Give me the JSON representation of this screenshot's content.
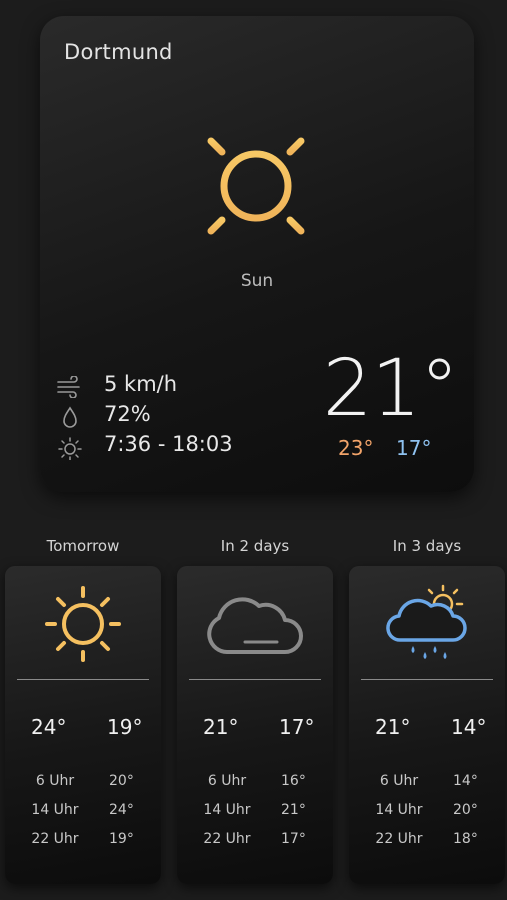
{
  "current": {
    "city": "Dortmund",
    "condition": "Sun",
    "condition_icon": "sun-icon",
    "wind": "5 km/h",
    "humidity": "72%",
    "sun_times": "7:36 - 18:03",
    "temperature": "21°",
    "high": "23°",
    "low": "17°",
    "colors": {
      "sun": "#f5c060",
      "high": "#f2a46a",
      "low": "#8fc2f0"
    }
  },
  "forecast": [
    {
      "label": "Tomorrow",
      "icon": "sun-icon",
      "high": "24°",
      "low": "19°",
      "hours": [
        {
          "time": "6 Uhr",
          "temp": "20°"
        },
        {
          "time": "14 Uhr",
          "temp": "24°"
        },
        {
          "time": "22 Uhr",
          "temp": "19°"
        }
      ]
    },
    {
      "label": "In 2 days",
      "icon": "cloud-icon",
      "high": "21°",
      "low": "17°",
      "hours": [
        {
          "time": "6 Uhr",
          "temp": "16°"
        },
        {
          "time": "14 Uhr",
          "temp": "21°"
        },
        {
          "time": "22 Uhr",
          "temp": "17°"
        }
      ]
    },
    {
      "label": "In 3 days",
      "icon": "rain-sun-cloud-icon",
      "high": "21°",
      "low": "14°",
      "hours": [
        {
          "time": "6 Uhr",
          "temp": "14°"
        },
        {
          "time": "14 Uhr",
          "temp": "20°"
        },
        {
          "time": "22 Uhr",
          "temp": "18°"
        }
      ]
    }
  ]
}
